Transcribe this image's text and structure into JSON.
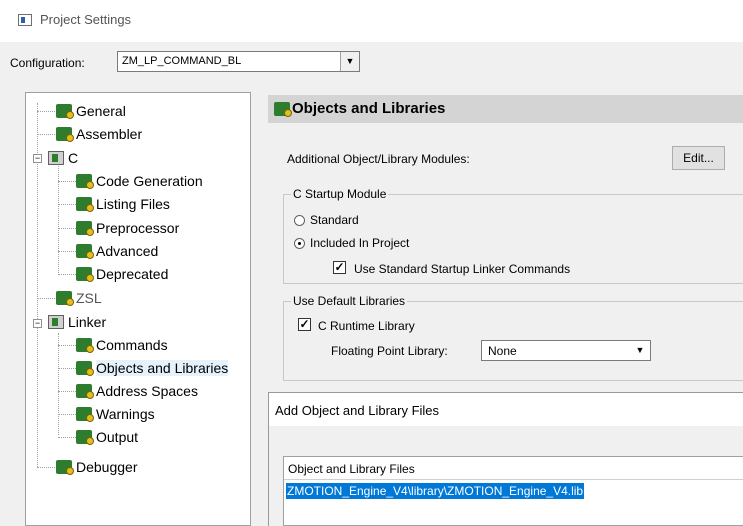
{
  "window": {
    "title": "Project Settings"
  },
  "configuration": {
    "label": "Configuration:",
    "value": "ZM_LP_COMMAND_BL"
  },
  "tree": {
    "items": [
      {
        "label": "General"
      },
      {
        "label": "Assembler"
      },
      {
        "label": "C"
      },
      {
        "label": "Code Generation"
      },
      {
        "label": "Listing Files"
      },
      {
        "label": "Preprocessor"
      },
      {
        "label": "Advanced"
      },
      {
        "label": "Deprecated"
      },
      {
        "label": "ZSL"
      },
      {
        "label": "Linker"
      },
      {
        "label": "Commands"
      },
      {
        "label": "Objects and Libraries"
      },
      {
        "label": "Address Spaces"
      },
      {
        "label": "Warnings"
      },
      {
        "label": "Output"
      },
      {
        "label": "Debugger"
      }
    ],
    "selected": "Objects and Libraries"
  },
  "page": {
    "title": "Objects and Libraries",
    "additional_label": "Additional Object/Library Modules:",
    "edit_button": "Edit...",
    "startup_group": {
      "title": "C Startup Module",
      "standard": "Standard",
      "included": "Included In Project",
      "selected": "Included In Project",
      "use_linker_cmds": "Use Standard Startup Linker Commands",
      "use_linker_cmds_checked": true
    },
    "default_libs_group": {
      "title": "Use Default Libraries",
      "c_runtime": "C Runtime Library",
      "c_runtime_checked": true,
      "floating_label": "Floating Point Library:",
      "floating_value": "None"
    }
  },
  "dialog": {
    "title": "Add Object and Library Files",
    "list_header": "Object and Library Files",
    "selected_file": "ZMOTION_Engine_V4\\library\\ZMOTION_Engine_V4.lib"
  }
}
